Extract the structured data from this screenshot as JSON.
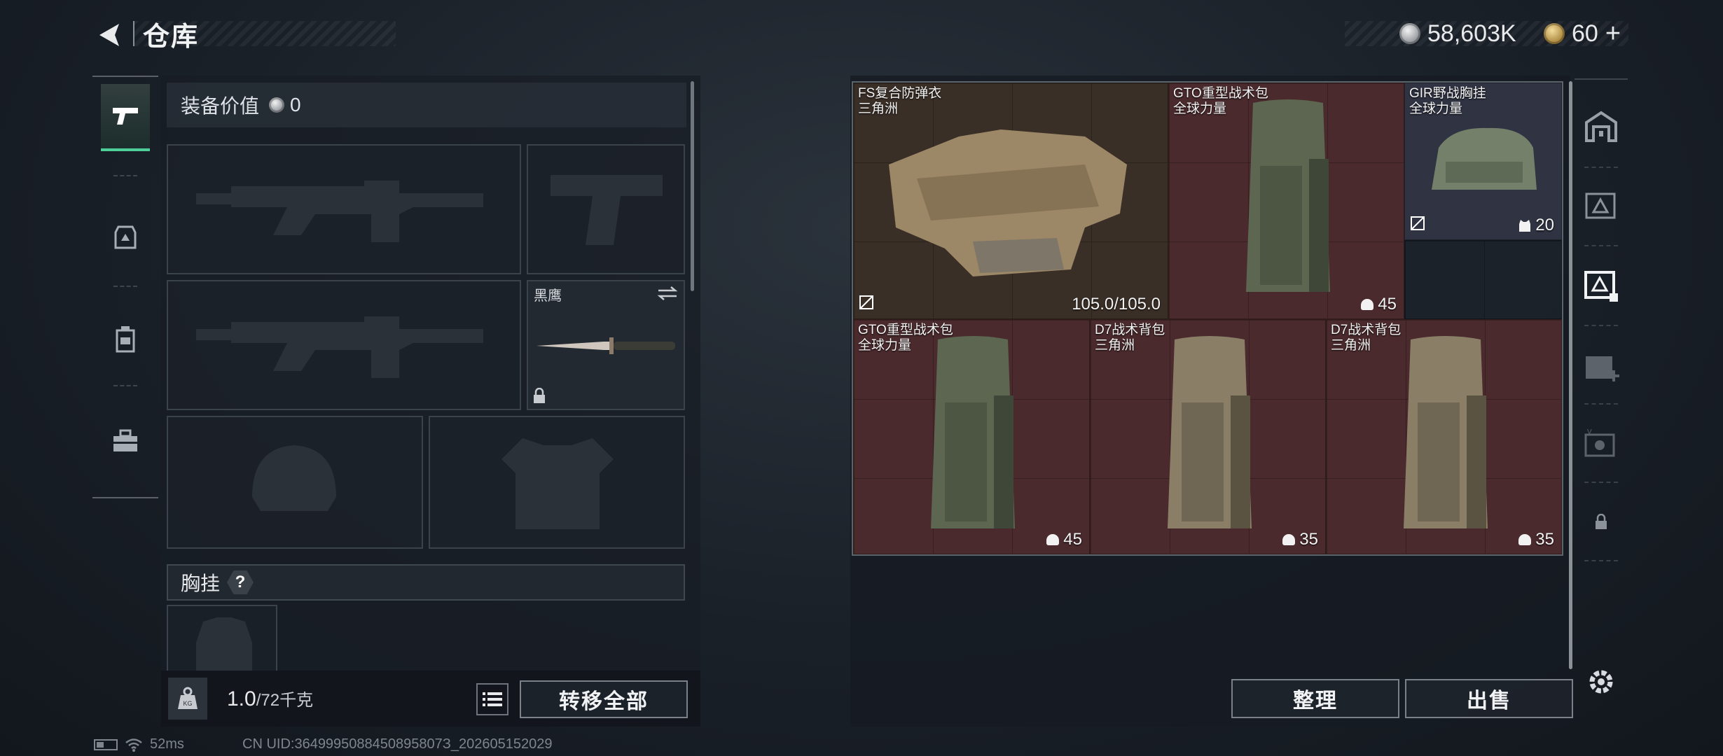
{
  "header": {
    "title": "仓库",
    "silver_amount": "58,603K",
    "gold_amount": "60"
  },
  "left_nav": {
    "items": [
      "pistol-icon",
      "helmet-bag-icon",
      "backpack-icon",
      "toolbox-icon"
    ],
    "active_index": 0
  },
  "equipment": {
    "value_label": "装备价值",
    "value_amount": "0",
    "melee_name": "黑鹰",
    "chest_label": "胸挂",
    "help_label": "?"
  },
  "footer_left": {
    "weight_current": "1.0",
    "weight_max": "/72千克",
    "transfer_all_label": "转移全部"
  },
  "storage_items": [
    {
      "name": "FS复合防弹衣",
      "origin": "三角洲",
      "value": "105.0/105.0",
      "color": "brown"
    },
    {
      "name": "GTO重型战术包",
      "origin": "全球力量",
      "value": "45",
      "color": "red"
    },
    {
      "name": "GIR野战胸挂",
      "origin": "全球力量",
      "value": "20",
      "color": "navy"
    },
    {
      "name": "GTO重型战术包",
      "origin": "全球力量",
      "value": "45",
      "color": "red"
    },
    {
      "name": "D7战术背包",
      "origin": "三角洲",
      "value": "35",
      "color": "red"
    },
    {
      "name": "D7战术背包",
      "origin": "三角洲",
      "value": "35",
      "color": "red"
    }
  ],
  "footer_right": {
    "organize_label": "整理",
    "sell_label": "出售"
  },
  "status_bar": {
    "ping": "52ms",
    "uid": "CN UID:3649995088450895807З_20260515202​9"
  },
  "colors": {
    "accent_green": "#4ecf9a",
    "cell_brown": "#3a2f27",
    "cell_red": "#4a2a2d",
    "cell_navy": "#2f3342"
  }
}
